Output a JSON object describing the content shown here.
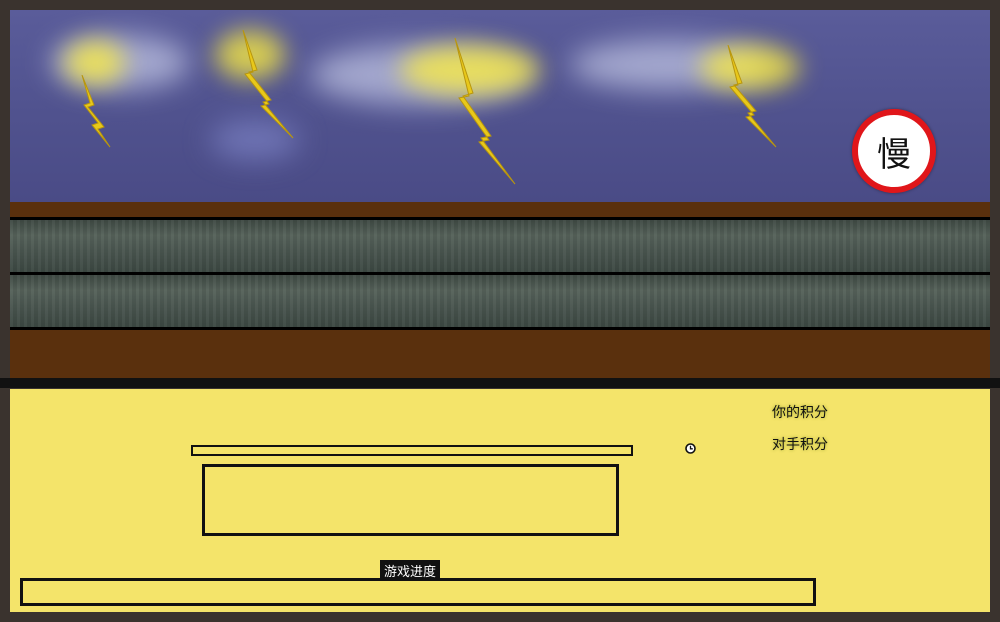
{
  "sky": {
    "bolt_color": "#e8c81a",
    "slow_sign": {
      "label": "慢",
      "border_color": "#e0161a"
    }
  },
  "track": {
    "lane_count": 2,
    "rail_color": "#5a300d"
  },
  "panel": {
    "background": "#f4e46a",
    "score_mine_label": "你的积分",
    "score_opponent_label": "对手积分",
    "progress_label": "游戏进度",
    "progress": 0
  }
}
